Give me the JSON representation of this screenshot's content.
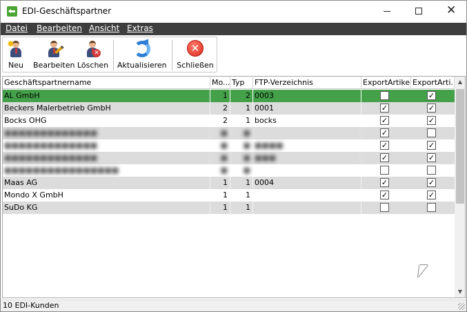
{
  "window": {
    "title": "EDI-Geschäftspartner"
  },
  "menu": [
    "Datei",
    "Bearbeiten",
    "Ansicht",
    "Extras"
  ],
  "toolbar": {
    "buttons": [
      {
        "label": "Neu",
        "icon": "new-partner-icon"
      },
      {
        "label": "Bearbeiten",
        "icon": "edit-partner-icon"
      },
      {
        "label": "Löschen",
        "icon": "delete-partner-icon"
      },
      {
        "label": "Aktualisieren",
        "icon": "refresh-icon"
      },
      {
        "label": "Schließen",
        "icon": "close-circle-icon"
      }
    ]
  },
  "table": {
    "columns": [
      "Geschäftspartnername",
      "Mo...",
      "Typ",
      "FTP-Verzeichnis",
      "ExportArtike...",
      "ExportArti..."
    ],
    "rows": [
      {
        "name": "AL GmbH",
        "mo": "1",
        "typ": "2",
        "ftp": "0003",
        "exp1": false,
        "exp2": true,
        "selected": true
      },
      {
        "name": "Beckers Malerbetrieb GmbH",
        "mo": "2",
        "typ": "1",
        "ftp": "0001",
        "exp1": true,
        "exp2": true
      },
      {
        "name": "Bocks OHG",
        "mo": "2",
        "typ": "1",
        "ftp": "bocks",
        "exp1": true,
        "exp2": true
      },
      {
        "name": "■■■■■■■■■■■■■",
        "mo": "■",
        "typ": "■",
        "ftp": "",
        "exp1": true,
        "exp2": false,
        "redacted": true
      },
      {
        "name": "■■■■■■■■■■■■■",
        "mo": "■",
        "typ": "■",
        "ftp": "■■■■",
        "exp1": true,
        "exp2": true,
        "redacted": true
      },
      {
        "name": "■■■■■■■■■■■■■",
        "mo": "■",
        "typ": "■",
        "ftp": "■■■",
        "exp1": true,
        "exp2": true,
        "redacted": true
      },
      {
        "name": "■■■■■■■■■■■■■■■■",
        "mo": "■",
        "typ": "■",
        "ftp": "",
        "exp1": false,
        "exp2": false,
        "redacted": true
      },
      {
        "name": "Maas AG",
        "mo": "1",
        "typ": "1",
        "ftp": "0004",
        "exp1": true,
        "exp2": true
      },
      {
        "name": "Mondo X GmbH",
        "mo": "1",
        "typ": "1",
        "ftp": "",
        "exp1": true,
        "exp2": true
      },
      {
        "name": "SuDo KG",
        "mo": "1",
        "typ": "1",
        "ftp": "",
        "exp1": false,
        "exp2": false
      }
    ]
  },
  "status": {
    "text": "10 EDI-Kunden"
  },
  "colors": {
    "selection": "#44a14a",
    "alt_row": "#dcdcdc",
    "menubar": "#3e3e3e"
  }
}
